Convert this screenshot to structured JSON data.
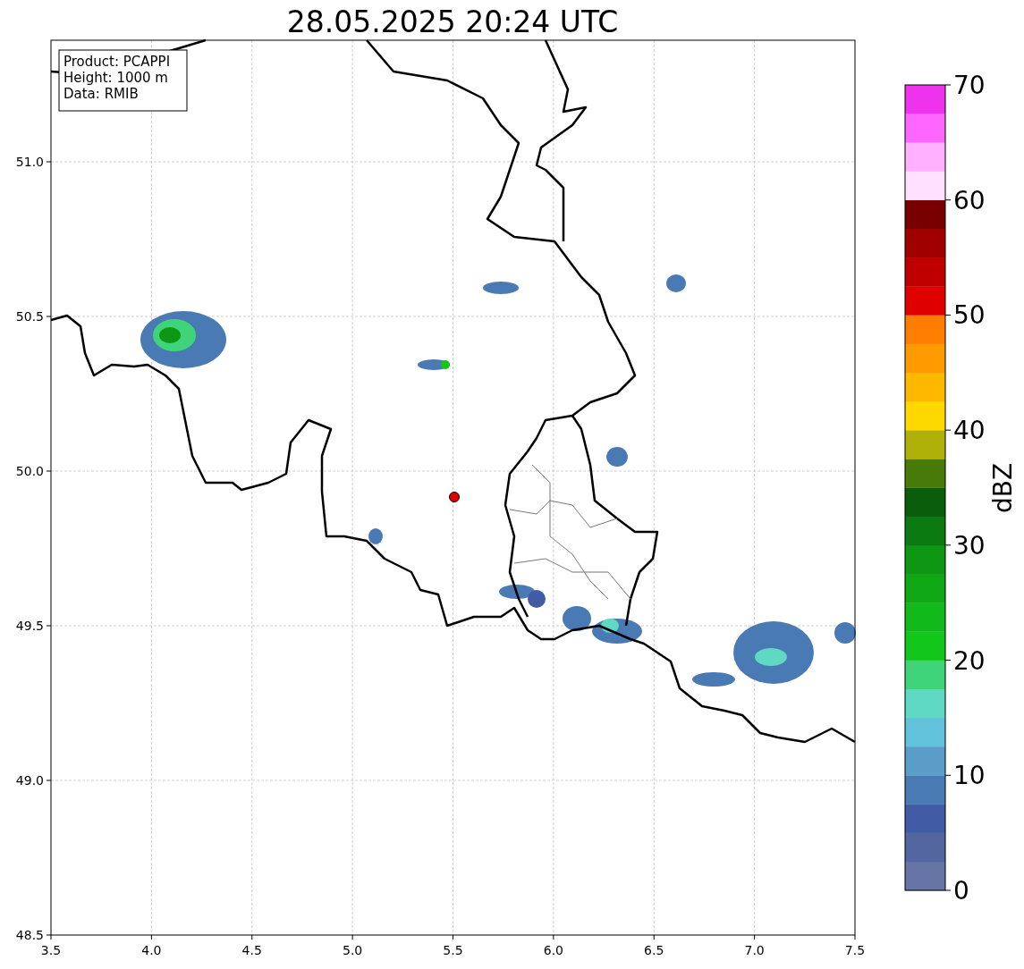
{
  "title": "28.05.2025 20:24 UTC",
  "info_box": [
    "Product: PCAPPI",
    "Height: 1000 m",
    "Data: RMIB"
  ],
  "map": {
    "x_ticks": [
      "3.5",
      "4.0",
      "4.5",
      "5.0",
      "5.5",
      "6.0",
      "6.5",
      "7.0",
      "7.5"
    ],
    "y_ticks": [
      "51.0",
      "50.5",
      "50.0",
      "49.5",
      "49.0",
      "48.5"
    ]
  },
  "colorbar": {
    "label": "dBZ",
    "ticks": [
      "70",
      "60",
      "50",
      "40",
      "30",
      "20",
      "10",
      "0"
    ],
    "segments": [
      {
        "color": "#6674a6"
      },
      {
        "color": "#5366a0"
      },
      {
        "color": "#425ba5"
      },
      {
        "color": "#4a7ab3"
      },
      {
        "color": "#5a9dc8"
      },
      {
        "color": "#62c2dc"
      },
      {
        "color": "#5fd8c4"
      },
      {
        "color": "#3fd47a"
      },
      {
        "color": "#12c61c"
      },
      {
        "color": "#11b91a"
      },
      {
        "color": "#10a815"
      },
      {
        "color": "#0e9713"
      },
      {
        "color": "#0b7a10"
      },
      {
        "color": "#0a5e0b"
      },
      {
        "color": "#487a0a"
      },
      {
        "color": "#b0b00a"
      },
      {
        "color": "#ffd800"
      },
      {
        "color": "#ffb800"
      },
      {
        "color": "#ff9a00"
      },
      {
        "color": "#ff7d00"
      },
      {
        "color": "#e00000"
      },
      {
        "color": "#c00000"
      },
      {
        "color": "#a00000"
      },
      {
        "color": "#780000"
      },
      {
        "color": "#ffe0ff"
      },
      {
        "color": "#ffb0ff"
      },
      {
        "color": "#ff66ff"
      },
      {
        "color": "#ee33ee"
      }
    ]
  }
}
